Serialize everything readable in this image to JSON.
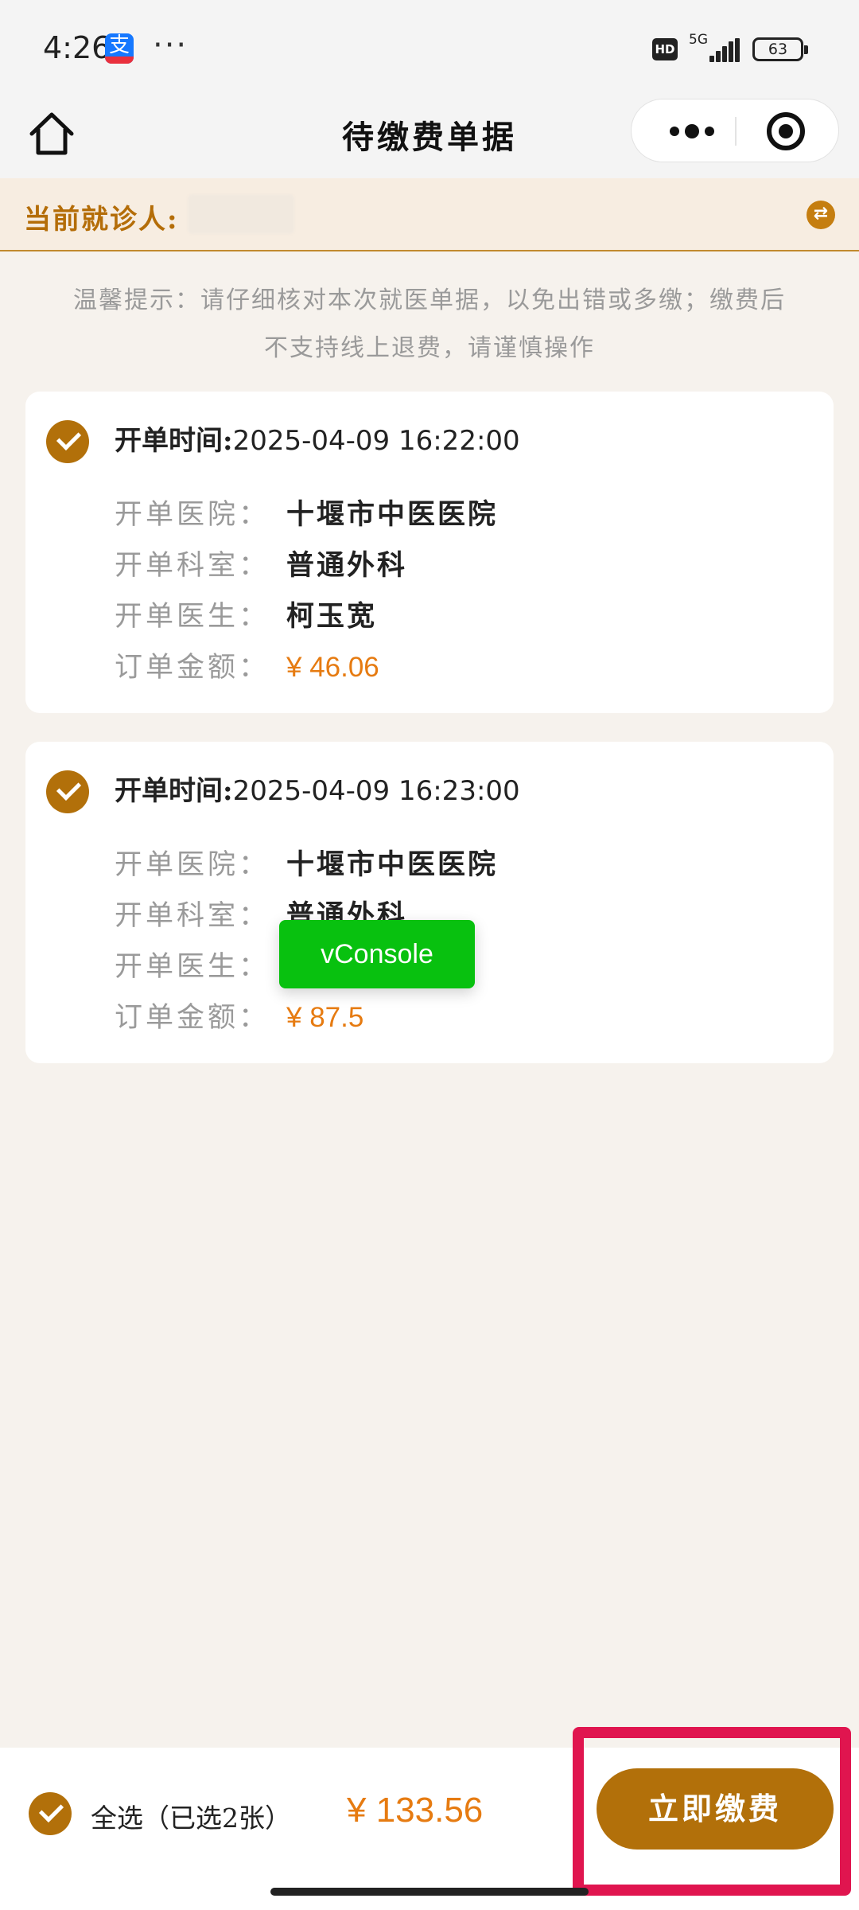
{
  "status_bar": {
    "time": "4:26",
    "app_badge_char": "支",
    "dots": "···",
    "hd": "HD",
    "network": "5G",
    "battery": "63"
  },
  "nav": {
    "title": "待缴费单据",
    "more_icon": "more-dots-icon",
    "close_icon": "target-icon",
    "home_icon": "home-icon"
  },
  "patient": {
    "label": "当前就诊人:",
    "switch_icon": "switch-arrows-icon"
  },
  "notice": {
    "line1": "温馨提示：请仔细核对本次就医单据，以免出错或多缴；缴费后",
    "line2": "不支持线上退费，请谨慎操作"
  },
  "labels": {
    "time": "开单时间:",
    "hospital": "开单医院：",
    "dept": "开单科室：",
    "doctor": "开单医生：",
    "amount": "订单金额："
  },
  "orders": [
    {
      "time": "2025-04-09 16:22:00",
      "hospital": "十堰市中医医院",
      "dept": "普通外科",
      "doctor": "柯玉宽",
      "amount": "¥ 46.06"
    },
    {
      "time": "2025-04-09 16:23:00",
      "hospital": "十堰市中医医院",
      "dept": "普通外科",
      "doctor": "",
      "amount": "¥ 87.5"
    }
  ],
  "vconsole": "vConsole",
  "bottom": {
    "select_all": "全选（已选2张）",
    "total": "¥ 133.56",
    "pay_button": "立即缴费"
  },
  "colors": {
    "accent": "#b2700a",
    "price": "#e67b11",
    "highlight": "#e0154f",
    "vconsole": "#08c10f"
  }
}
